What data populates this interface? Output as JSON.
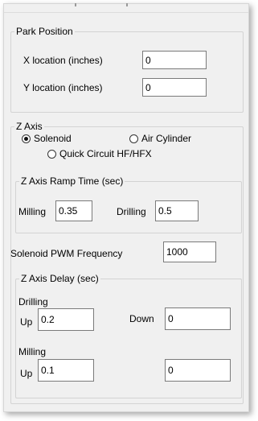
{
  "park_position": {
    "title": "Park Position",
    "x_label": "X location (inches)",
    "x_value": "0",
    "y_label": "Y location (inches)",
    "y_value": "0"
  },
  "z_axis": {
    "title": "Z Axis",
    "radio_solenoid": "Solenoid",
    "radio_air_cylinder": "Air Cylinder",
    "radio_quick_circuit": "Quick Circuit HF/HFX",
    "selected": "Solenoid",
    "ramp": {
      "title": "Z Axis Ramp Time (sec)",
      "milling_label": "Milling",
      "milling_value": "0.35",
      "drilling_label": "Drilling",
      "drilling_value": "0.5"
    },
    "pwm_label": "Solenoid PWM Frequency",
    "pwm_value": "1000",
    "delay": {
      "title": "Z Axis Delay (sec)",
      "drilling_label": "Drilling",
      "drilling_up_label": "Up",
      "drilling_up_value": "0.2",
      "drilling_down_label": "Down",
      "drilling_down_value": "0",
      "milling_label": "Milling",
      "milling_up_label": "Up",
      "milling_up_value": "0.1",
      "milling_down_value": "0"
    }
  }
}
